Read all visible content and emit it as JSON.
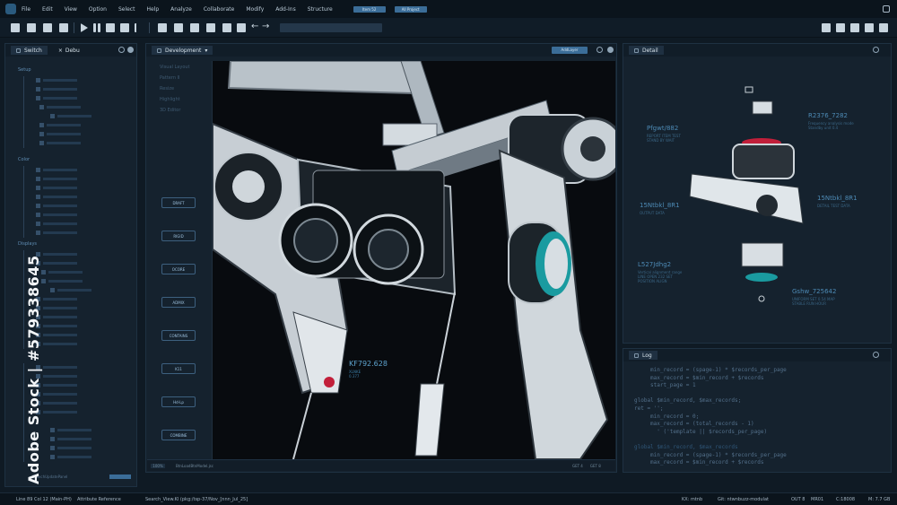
{
  "menu": {
    "items": [
      "File",
      "Edit",
      "View",
      "Option",
      "Select",
      "Help",
      "Analyze",
      "Collaborate",
      "Modify",
      "Add-Ins",
      "Structure"
    ],
    "field_a": "Item 52",
    "field_b": "All Project"
  },
  "left_panel": {
    "tab_active": "Switch",
    "tab_other": "Debu",
    "sections": [
      "Setup",
      "Color",
      "Displays"
    ],
    "footer_text": "BranchUpdatePanel"
  },
  "dev_panel": {
    "title": "Development",
    "badge": "AddLayer",
    "side_labels": [
      "Visual Layout",
      "Pattern II",
      "Resize",
      "Highlight",
      "3D Editor"
    ],
    "side_buttons": [
      "DRAFT",
      "RIGID",
      "OCORE",
      "ADMIX",
      "CONTAINS",
      "K11",
      "Hd-Lp",
      "COMBINE"
    ],
    "callout_title": "KF792.628",
    "callout_sub": "XLNKE\n0.377",
    "status_left": "100%",
    "status_text": "BtnLoadBtnModel.jsc",
    "status_mid": "GET 4",
    "status_right": "GET 8"
  },
  "detail_panel": {
    "title": "Detail",
    "labels": [
      {
        "text": "Pfgwt/882",
        "sub": "REPORT ITEM TEST\nSTAND BY WAIT"
      },
      {
        "text": "R2376_7282",
        "sub": "Frequency analysis mode\nStandby unit 0.4"
      },
      {
        "text": "15Ntbkl_8R1",
        "sub": "DETAIL TEST DATA"
      },
      {
        "text": "15Ntbkl_8R1",
        "sub": "OUTPUT DATA"
      },
      {
        "text": "L527Jdhg2",
        "sub": "Vertical alignment range\nLINE OPEN 232 SET\nPOSITION ALIGN"
      },
      {
        "text": "Gshw_725642",
        "sub": "UNIFORM SET 0.54 MAP\nSTABLE RUN HOUR"
      }
    ]
  },
  "log_panel": {
    "title": "Log",
    "lines": [
      {
        "text": "     min_record = (spage-1) * $records_per_page",
        "dim": false
      },
      {
        "text": "     max_record = $min_record + $records",
        "dim": false
      },
      {
        "text": "     start_page = 1",
        "dim": false
      },
      {
        "text": "",
        "dim": false
      },
      {
        "text": "global $min_record, $max_records;",
        "dim": false
      },
      {
        "text": "ret = '';",
        "dim": false
      },
      {
        "text": "     min_record = 0;",
        "dim": false
      },
      {
        "text": "     max_record = (total_records - 1)",
        "dim": false
      },
      {
        "text": "       ' ('template || $records_per_page)",
        "dim": false
      },
      {
        "text": "",
        "dim": false
      },
      {
        "text": "global $min_record, $max_records",
        "dim": true
      },
      {
        "text": "     min_record = (spage-1) * $records_per_page",
        "dim": false
      },
      {
        "text": "     max_record = $min_record + $records",
        "dim": false
      }
    ]
  },
  "status": {
    "left": "Line 89 Col 12 (Main-PH)",
    "attr": "Attribute Reference",
    "search": "Search_View.Kl (pkg:/tsp-37/Nov_[nnn_Jul_25]",
    "kx": "KX: mtnb",
    "git": "Git: ntwnbuzz-modulat",
    "out": "OUT 8",
    "mode": "MR01",
    "coords": "C:18008",
    "mem": "M: 7.7 GB"
  },
  "watermark": {
    "text": "Adobe Stock | #579338645"
  },
  "colors": {
    "accent": "#3b6d98",
    "panel": "#15222e",
    "viewport": "#080b0f",
    "label_blue": "#4d8ab5"
  }
}
